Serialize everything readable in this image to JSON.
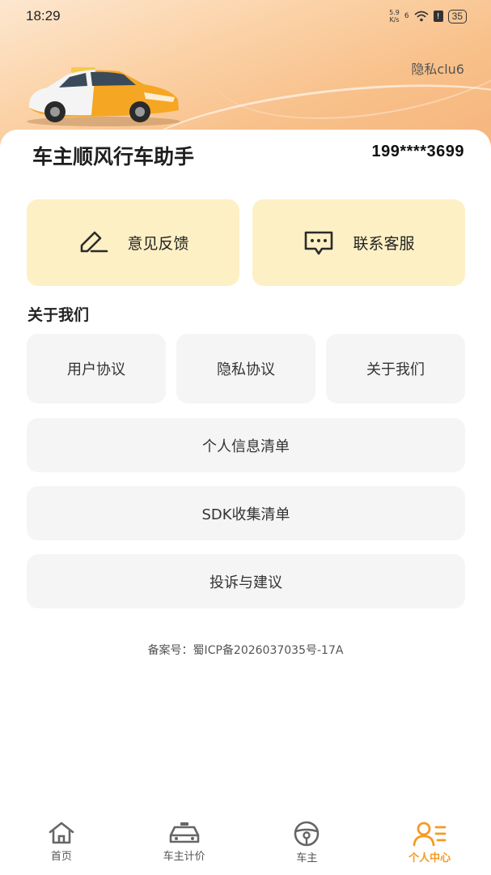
{
  "status_bar": {
    "time": "18:29",
    "net_speed_value": "5.9",
    "net_speed_unit": "K/s",
    "signal_label": "6",
    "battery": "35"
  },
  "header": {
    "privacy_link": "隐私clu6"
  },
  "profile": {
    "app_title": "车主顺风行车助手",
    "phone": "199****3699"
  },
  "quick_actions": [
    {
      "label": "意见反馈",
      "icon": "edit-icon"
    },
    {
      "label": "联系客服",
      "icon": "message-icon"
    }
  ],
  "about": {
    "title": "关于我们",
    "row_buttons": [
      "用户协议",
      "隐私协议",
      "关于我们"
    ],
    "list_buttons": [
      "个人信息清单",
      "SDK收集清单",
      "投诉与建议"
    ]
  },
  "icp": "备案号：蜀ICP备2026037035号-17A",
  "tabbar": {
    "tabs": [
      {
        "label": "首页",
        "icon": "home-icon"
      },
      {
        "label": "车主计价",
        "icon": "car-icon"
      },
      {
        "label": "车主",
        "icon": "steering-wheel-icon"
      },
      {
        "label": "个人中心",
        "icon": "user-icon"
      }
    ],
    "active_index": 3
  },
  "colors": {
    "accent": "#f59a23",
    "card_yellow": "#fdf0c5",
    "button_gray": "#f5f5f5"
  }
}
